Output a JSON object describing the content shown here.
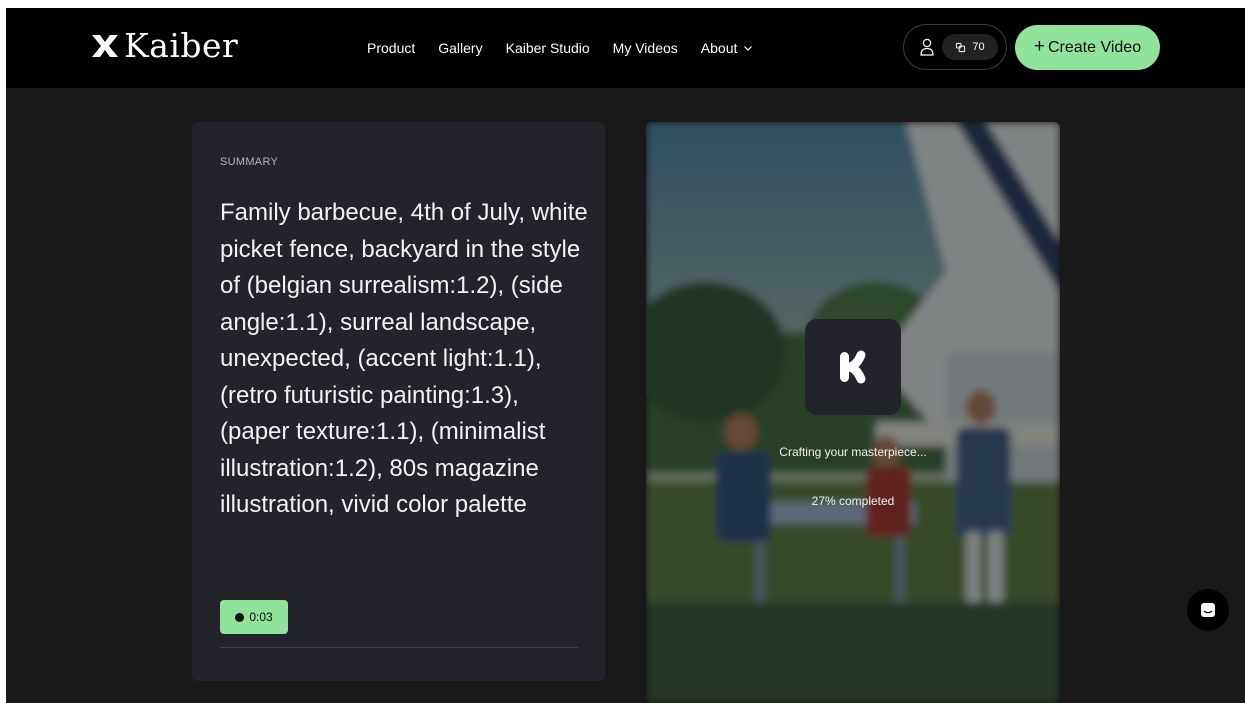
{
  "header": {
    "brand": "Kaiber",
    "nav": [
      {
        "label": "Product"
      },
      {
        "label": "Gallery"
      },
      {
        "label": "Kaiber Studio"
      },
      {
        "label": "My Videos"
      },
      {
        "label": "About"
      }
    ],
    "credits": "70",
    "create_label": "Create Video"
  },
  "summary": {
    "label": "SUMMARY",
    "text": "Family barbecue, 4th of July, white picket fence, backyard in the style of (belgian surrealism:1.2), (side angle:1.1), surreal landscape, unexpected, (accent light:1.1), (retro futuristic painting:1.3), (paper texture:1.1), (minimalist illustration:1.2), 80s magazine illustration, vivid color palette",
    "duration": "0:03"
  },
  "preview": {
    "status": "Crafting your masterpiece...",
    "progress_text": "27% completed",
    "progress_percent": 27
  },
  "colors": {
    "accent": "#8fe39b",
    "header_bg": "#000000",
    "page_bg": "#191919",
    "card_bg": "#22232b"
  },
  "icons": {
    "logo": "kaiber-logo-icon",
    "user": "user-icon",
    "credits": "credits-icon",
    "about_chevron": "chevron-down-icon",
    "loader": "kaiber-k-icon",
    "chat": "chat-icon"
  }
}
